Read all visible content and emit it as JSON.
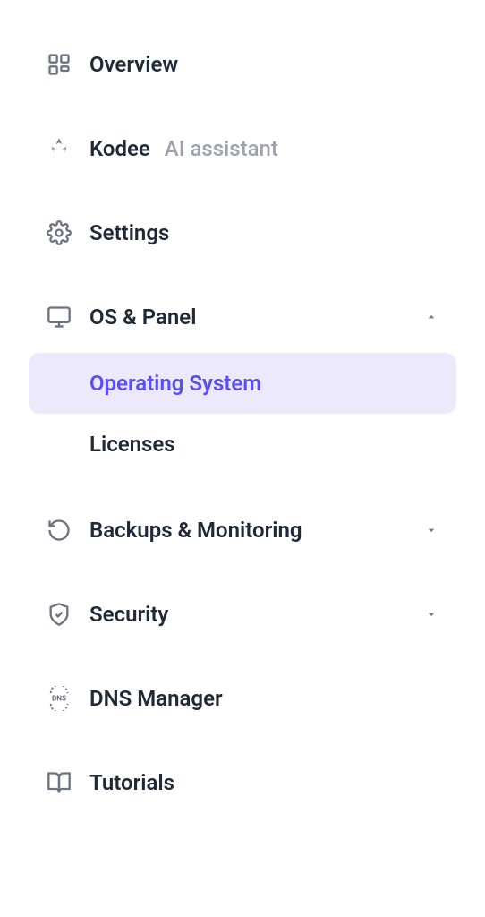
{
  "sidebar": {
    "items": [
      {
        "id": "overview",
        "label": "Overview",
        "icon": "dashboard-icon"
      },
      {
        "id": "kodee",
        "label": "Kodee",
        "suffix": "AI assistant",
        "icon": "ai-icon"
      },
      {
        "id": "settings",
        "label": "Settings",
        "icon": "gear-icon"
      },
      {
        "id": "os-panel",
        "label": "OS & Panel",
        "icon": "monitor-icon",
        "expanded": true,
        "submenu": [
          {
            "id": "operating-system",
            "label": "Operating System",
            "active": true
          },
          {
            "id": "licenses",
            "label": "Licenses",
            "active": false
          }
        ]
      },
      {
        "id": "backups",
        "label": "Backups & Monitoring",
        "icon": "history-icon",
        "expanded": false,
        "submenu": []
      },
      {
        "id": "security",
        "label": "Security",
        "icon": "shield-icon",
        "expanded": false,
        "submenu": []
      },
      {
        "id": "dns",
        "label": "DNS Manager",
        "icon": "dns-icon"
      },
      {
        "id": "tutorials",
        "label": "Tutorials",
        "icon": "book-icon"
      }
    ]
  },
  "colors": {
    "text_primary": "#1f2937",
    "text_muted": "#9ca3af",
    "icon": "#6b7280",
    "active_bg": "#ebe9fb",
    "active_text": "#5b4ef5"
  }
}
